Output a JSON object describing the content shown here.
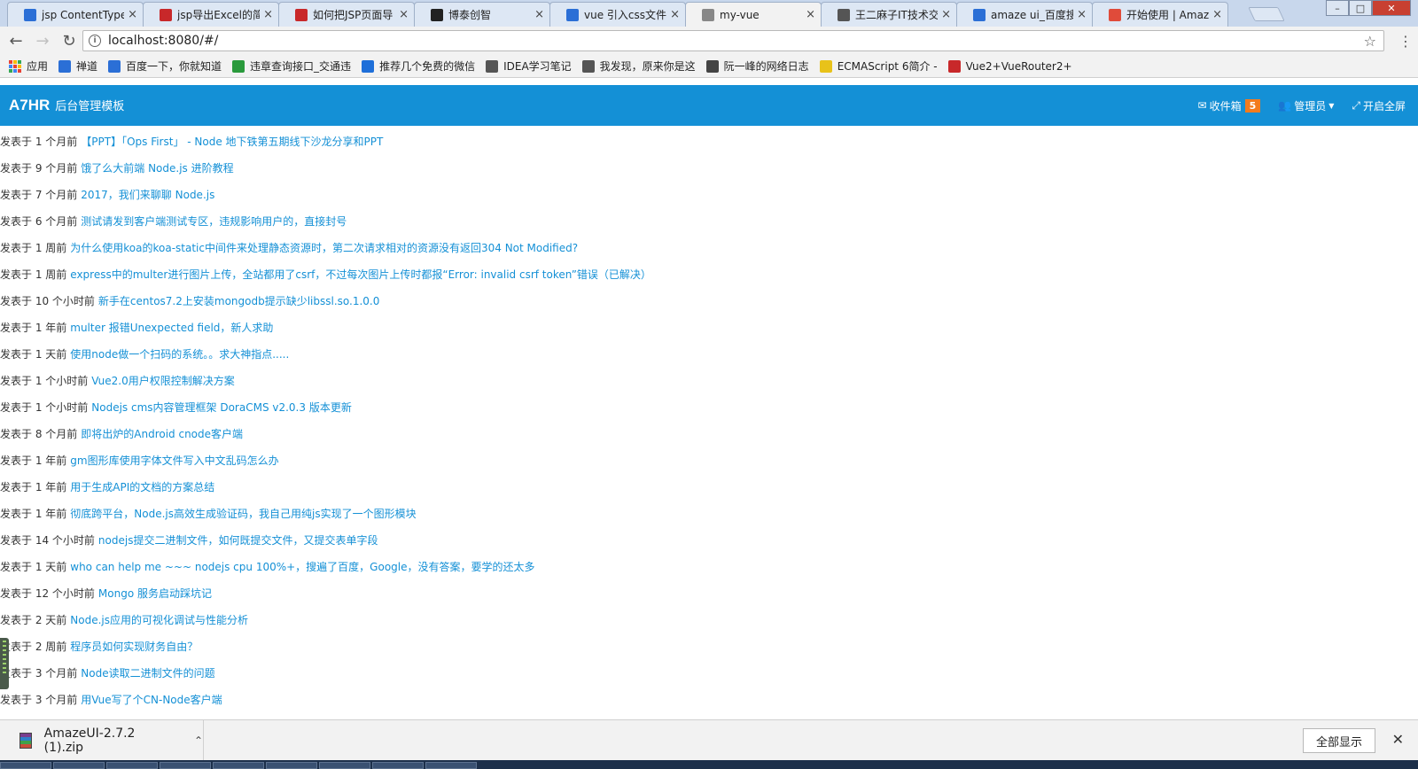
{
  "browser": {
    "tabs": [
      {
        "title": "jsp ContentType",
        "icon": "baidu-paw-icon",
        "color": "#2b6fd6"
      },
      {
        "title": "jsp导出Excel的简",
        "icon": "csdn-icon",
        "color": "#c8282a"
      },
      {
        "title": "如何把JSP页面导",
        "icon": "csdn-icon",
        "color": "#c8282a"
      },
      {
        "title": "博泰创智",
        "icon": "github-icon",
        "color": "#222222"
      },
      {
        "title": "vue 引入css文件",
        "icon": "baidu-paw-icon",
        "color": "#2b6fd6"
      },
      {
        "title": "my-vue",
        "icon": "page-icon",
        "color": "#888888",
        "active": true
      },
      {
        "title": "王二麻子IT技术交",
        "icon": "scissors-icon",
        "color": "#555555"
      },
      {
        "title": "amaze ui_百度搜",
        "icon": "baidu-paw-icon",
        "color": "#2b6fd6"
      },
      {
        "title": "开始使用 | Amaz",
        "icon": "amaze-icon",
        "color": "#e04b3a"
      }
    ],
    "tab_close_glyph": "×",
    "window_controls": {
      "minimize": "–",
      "maximize": "□",
      "close": "✕"
    },
    "nav": {
      "back": "←",
      "forward": "→",
      "reload": "↻"
    },
    "address": "localhost:8080/#/",
    "star": "☆",
    "menu": "⋮",
    "bookmarks": [
      {
        "label": "应用",
        "icon": "apps-grid-icon"
      },
      {
        "label": "禅道",
        "icon": "zentao-icon",
        "color": "#2b6fd6"
      },
      {
        "label": "百度一下，你就知道",
        "icon": "baidu-paw-icon",
        "color": "#2b6fd6"
      },
      {
        "label": "违章查询接口_交通违",
        "icon": "juhe-icon",
        "color": "#2a9a3c"
      },
      {
        "label": "推荐几个免费的微信",
        "icon": "zhihu-icon",
        "color": "#1e6fd9"
      },
      {
        "label": "IDEA学习笔记",
        "icon": "scissors-icon",
        "color": "#555555"
      },
      {
        "label": "我发现，原来你是这",
        "icon": "scissors-icon",
        "color": "#555555"
      },
      {
        "label": "阮一峰的网络日志",
        "icon": "ruanyf-icon",
        "color": "#444444"
      },
      {
        "label": "ECMAScript 6简介 -",
        "icon": "es-icon",
        "color": "#e8c21a"
      },
      {
        "label": "Vue2+VueRouter2+",
        "icon": "csdn-icon",
        "color": "#c8282a"
      }
    ]
  },
  "header": {
    "brand": "A7HR",
    "subtitle": "后台管理模板",
    "inbox": {
      "label": "收件箱",
      "count": "5"
    },
    "admin": {
      "label": "管理员"
    },
    "fullscreen": {
      "label": "开启全屏"
    },
    "brand_color": "#1490d6",
    "badge_color": "#f37b1d"
  },
  "topics": [
    {
      "meta": "发表于 1 个月前",
      "title": "【PPT】「Ops First」 - Node 地下铁第五期线下沙龙分享和PPT"
    },
    {
      "meta": "发表于 9 个月前",
      "title": "饿了么大前端 Node.js 进阶教程"
    },
    {
      "meta": "发表于 7 个月前",
      "title": "2017，我们来聊聊 Node.js"
    },
    {
      "meta": "发表于 6 个月前",
      "title": "测试请发到客户端测试专区，违规影响用户的，直接封号"
    },
    {
      "meta": "发表于 1 周前",
      "title": "为什么使用koa的koa-static中间件来处理静态资源时，第二次请求相对的资源没有返回304 Not Modified?"
    },
    {
      "meta": "发表于 1 周前",
      "title": "express中的multer进行图片上传，全站都用了csrf，不过每次图片上传时都报“Error: invalid csrf token”错误（已解决）"
    },
    {
      "meta": "发表于 10 个小时前",
      "title": "新手在centos7.2上安装mongodb提示缺少libssl.so.1.0.0"
    },
    {
      "meta": "发表于 1 年前",
      "title": "multer 报错Unexpected field，新人求助"
    },
    {
      "meta": "发表于 1 天前",
      "title": "使用node做一个扫码的系统。。求大神指点....."
    },
    {
      "meta": "发表于 1 个小时前",
      "title": "Vue2.0用户权限控制解决方案"
    },
    {
      "meta": "发表于 1 个小时前",
      "title": "Nodejs cms内容管理框架 DoraCMS v2.0.3 版本更新"
    },
    {
      "meta": "发表于 8 个月前",
      "title": "即将出炉的Android cnode客户端"
    },
    {
      "meta": "发表于 1 年前",
      "title": "gm图形库使用字体文件写入中文乱码怎么办"
    },
    {
      "meta": "发表于 1 年前",
      "title": "用于生成API的文档的方案总结"
    },
    {
      "meta": "发表于 1 年前",
      "title": "彻底跨平台，Node.js高效生成验证码，我自己用纯js实现了一个图形模块"
    },
    {
      "meta": "发表于 14 个小时前",
      "title": "nodejs提交二进制文件，如何既提交文件，又提交表单字段"
    },
    {
      "meta": "发表于 1 天前",
      "title": "who can help me ~~~ nodejs cpu 100%+，搜遍了百度，Google，没有答案，要学的还太多"
    },
    {
      "meta": "发表于 12 个小时前",
      "title": "Mongo 服务启动踩坑记"
    },
    {
      "meta": "发表于 2 天前",
      "title": "Node.js应用的可视化调试与性能分析"
    },
    {
      "meta": "发表于 2 周前",
      "title": "程序员如何实现财务自由？"
    },
    {
      "meta": "发表于 3 个月前",
      "title": "Node读取二进制文件的问题"
    },
    {
      "meta": "发表于 3 个月前",
      "title": "用Vue写了个CN-Node客户端"
    }
  ],
  "downloads": {
    "file": "AmazeUI-2.7.2 (1).zip",
    "chevron": "⌃",
    "show_all": "全部显示",
    "close": "✕"
  }
}
